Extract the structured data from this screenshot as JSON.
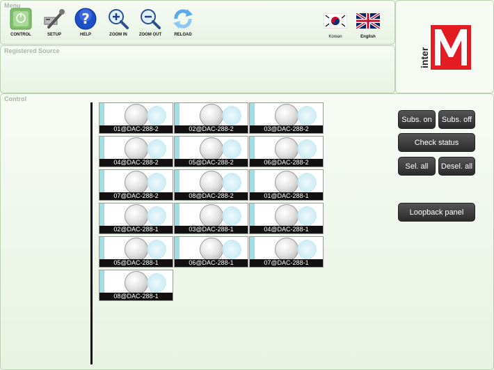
{
  "menu": {
    "title": "Menu",
    "tools": [
      {
        "id": "control",
        "label": "CONTROL"
      },
      {
        "id": "setup",
        "label": "SETUP"
      },
      {
        "id": "help",
        "label": "HELP"
      },
      {
        "id": "zoom_in",
        "label": "ZOOM IN"
      },
      {
        "id": "zoom_out",
        "label": "ZOOM OUT"
      },
      {
        "id": "reload",
        "label": "RELOAD"
      }
    ],
    "languages": [
      {
        "id": "korean",
        "label": "Korean"
      },
      {
        "id": "english",
        "label": "English"
      }
    ]
  },
  "registered_source": {
    "title": "Registered Source"
  },
  "logo": {
    "text": "inter",
    "letter": "M",
    "color": "#e31b23"
  },
  "control": {
    "title": "Control",
    "devices": [
      "01@DAC-288-2",
      "02@DAC-288-2",
      "03@DAC-288-2",
      "04@DAC-288-2",
      "05@DAC-288-2",
      "06@DAC-288-2",
      "07@DAC-288-2",
      "08@DAC-288-2",
      "01@DAC-288-1",
      "02@DAC-288-1",
      "03@DAC-288-1",
      "04@DAC-288-1",
      "05@DAC-288-1",
      "06@DAC-288-1",
      "07@DAC-288-1",
      "08@DAC-288-1"
    ],
    "buttons": {
      "subs_on": "Subs. on",
      "subs_off": "Subs. off",
      "check_status": "Check status",
      "sel_all": "Sel. all",
      "desel_all": "Desel. all",
      "loopback_panel": "Loopback panel"
    }
  }
}
